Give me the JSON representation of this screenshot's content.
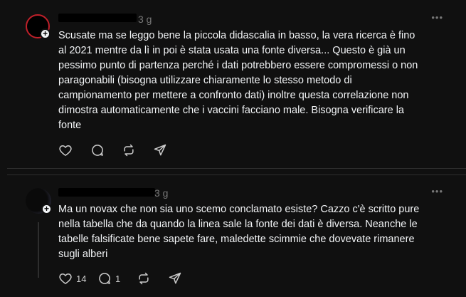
{
  "posts": [
    {
      "time": "3 g",
      "text": "Scusate ma se leggo bene la piccola didascalia in basso, la vera ricerca è fino\nal 2021 mentre da lì in poi è stata usata una fonte diversa... Questo è già un\npessimo punto di partenza perché i dati potrebbero essere compromessi o non\nparagonabili (bisogna utilizzare chiaramente lo stesso metodo di\ncampionamento per mettere a confronto dati) inoltre questa correlazione non\ndimostra automaticamente che i vaccini facciano male. Bisogna verificare la\nfonte",
      "actions": {
        "like_count": "",
        "reply_count": ""
      }
    },
    {
      "time": "3 g",
      "text": "Ma un novax che non sia uno scemo conclamato esiste? Cazzo c'è scritto pure\nnella tabella che da quando la linea sale la fonte dei dati è diversa. Neanche le\ntabelle falsificate bene sapete fare, maledette scimmie che dovevate rimanere\nsugli alberi",
      "actions": {
        "like_count": "14",
        "reply_count": "1"
      }
    }
  ],
  "icons": {
    "more": "more-horizontal-icon",
    "like": "heart-icon",
    "reply": "comment-icon",
    "repost": "repost-icon",
    "share": "send-icon",
    "follow": "plus-icon"
  },
  "colors": {
    "background": "#101010",
    "text": "#f3f5f7",
    "muted": "#777777",
    "avatar_ring": "#c0202a"
  }
}
